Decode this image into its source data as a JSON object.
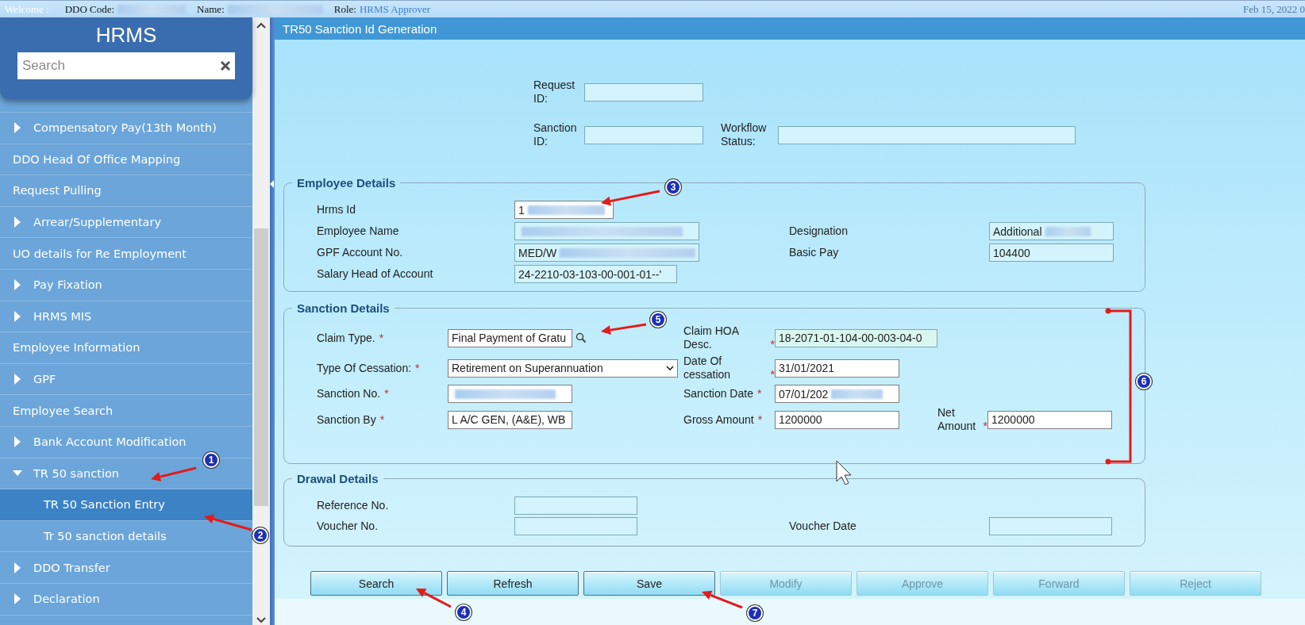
{
  "top_bar": {
    "welcome": "Welcome :",
    "ddo_code_label": "DDO Code:",
    "name_label": "Name:",
    "role_label": "Role:",
    "role": "HRMS Approver",
    "date": "Feb 15, 2022 0"
  },
  "sidebar": {
    "title": "HRMS",
    "search": {
      "placeholder": "Search"
    },
    "items": [
      {
        "label": "Compensatory Pay(13th Month)",
        "kind": "group",
        "expanded": false,
        "selected": false
      },
      {
        "label": "DDO Head Of Office Mapping",
        "kind": "link",
        "selected": false
      },
      {
        "label": "Request Pulling",
        "kind": "link",
        "selected": false
      },
      {
        "label": "Arrear/Supplementary",
        "kind": "group",
        "expanded": false,
        "selected": false
      },
      {
        "label": "UO details for Re Employment",
        "kind": "link",
        "selected": false
      },
      {
        "label": "Pay Fixation",
        "kind": "group",
        "expanded": false,
        "selected": false
      },
      {
        "label": "HRMS MIS",
        "kind": "group",
        "expanded": false,
        "selected": false
      },
      {
        "label": "Employee Information",
        "kind": "link",
        "selected": false
      },
      {
        "label": "GPF",
        "kind": "group",
        "expanded": false,
        "selected": false
      },
      {
        "label": "Employee Search",
        "kind": "link",
        "selected": false
      },
      {
        "label": "Bank Account Modification",
        "kind": "group",
        "expanded": false,
        "selected": false
      },
      {
        "label": "TR 50 sanction",
        "kind": "group",
        "expanded": true,
        "selected": false,
        "children": [
          {
            "label": "TR 50 Sanction Entry",
            "selected": true
          },
          {
            "label": "Tr 50 sanction details",
            "selected": false
          }
        ]
      },
      {
        "label": "DDO Transfer",
        "kind": "group",
        "expanded": false,
        "selected": false
      },
      {
        "label": "Declaration",
        "kind": "group",
        "expanded": false,
        "selected": false
      }
    ]
  },
  "page_title": "TR50 Sanction Id Generation",
  "id_fields": [
    {
      "label": "Request ID:",
      "editable": false
    },
    {
      "label": "Sanction ID:",
      "editable": false
    },
    {
      "label": "Workflow Status:",
      "editable": false
    }
  ],
  "sections": [
    {
      "title": "Employee Details",
      "kind": "employee",
      "rows": [
        [
          {
            "label": "Hrms Id",
            "kind": "text",
            "editable": true,
            "value": "1",
            "blurred": true
          }
        ],
        [
          {
            "label": "Employee Name",
            "kind": "text",
            "editable": false,
            "blurred": true
          },
          {
            "label": "Designation",
            "kind": "text",
            "editable": false,
            "value": "Additional",
            "blurred": true
          }
        ],
        [
          {
            "label": "GPF Account No.",
            "kind": "text",
            "editable": false,
            "value": "MED/W",
            "blurred": true
          },
          {
            "label": "Basic Pay",
            "kind": "text",
            "editable": false,
            "value": "104400"
          }
        ],
        [
          {
            "label": "Salary Head of Account",
            "kind": "text",
            "editable": false,
            "value": "24-2210-03-103-00-001-01--'"
          }
        ]
      ]
    },
    {
      "title": "Sanction Details",
      "kind": "sanction",
      "rows": [
        [
          {
            "label": "Claim Type.",
            "required_mark": "*",
            "kind": "lookup",
            "editable": true,
            "value": "Final Payment of Gratu"
          },
          {
            "label": "Claim HOA Desc.",
            "required_mark": "*",
            "kind": "text",
            "editable": false,
            "value": "18-2071-01-104-00-003-04-0"
          }
        ],
        [
          {
            "label": "Type Of Cessation:",
            "required_mark": "*",
            "kind": "select",
            "editable": true,
            "value": "Retirement on Superannuation"
          },
          {
            "label": "Date Of cessation",
            "required_mark": "*",
            "kind": "text",
            "editable": true,
            "value": "31/01/2021"
          }
        ],
        [
          {
            "label": "Sanction No.",
            "required_mark": "*",
            "kind": "text",
            "editable": true,
            "blurred": true
          },
          {
            "label": "Sanction Date",
            "required_mark": "*",
            "kind": "text",
            "editable": true,
            "value": "07/01/202",
            "blurred": true
          }
        ],
        [
          {
            "label": "Sanction By",
            "required_mark": "*",
            "kind": "text",
            "editable": true,
            "value": "L A/C GEN, (A&E), WB"
          },
          {
            "label": "Gross Amount",
            "required_mark": "*",
            "kind": "text",
            "editable": true,
            "value": "1200000"
          },
          {
            "label": "Net Amount",
            "required_mark": "*",
            "kind": "text",
            "editable": true,
            "value": "1200000"
          }
        ]
      ]
    },
    {
      "title": "Drawal Details",
      "kind": "drawal",
      "rows": [
        [
          {
            "label": "Reference No.",
            "kind": "text",
            "editable": false
          }
        ],
        [
          {
            "label": "Voucher No.",
            "kind": "text",
            "editable": false
          },
          {
            "label": "Voucher Date",
            "kind": "text",
            "editable": false
          }
        ]
      ]
    }
  ],
  "buttons": [
    {
      "label": "Search",
      "disabled": false
    },
    {
      "label": "Refresh",
      "disabled": false
    },
    {
      "label": "Save",
      "disabled": false
    },
    {
      "label": "Modify",
      "disabled": true
    },
    {
      "label": "Approve",
      "disabled": true
    },
    {
      "label": "Forward",
      "disabled": true
    },
    {
      "label": "Reject",
      "disabled": true
    }
  ],
  "annotations": [
    {
      "number": "1",
      "kind": "arrow"
    },
    {
      "number": "2",
      "kind": "arrow"
    },
    {
      "number": "3",
      "kind": "arrow"
    },
    {
      "number": "4",
      "kind": "arrow"
    },
    {
      "number": "5",
      "kind": "arrow"
    },
    {
      "number": "6",
      "kind": "bracket"
    },
    {
      "number": "7",
      "kind": "arrow"
    }
  ]
}
